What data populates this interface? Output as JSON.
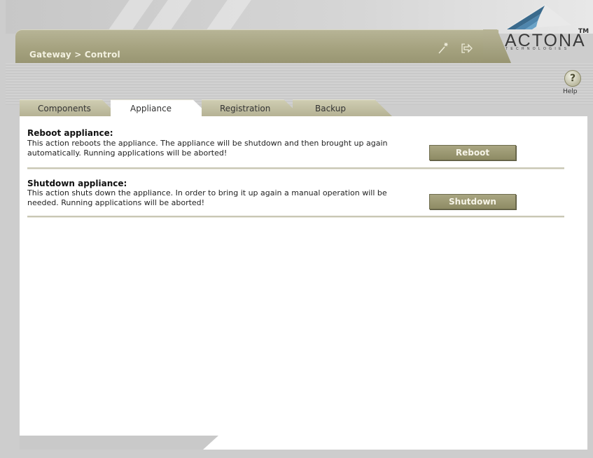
{
  "header": {
    "breadcrumb": "Gateway > Control",
    "icons": [
      "wand-icon",
      "logout-icon"
    ],
    "logo": {
      "word": "ACTONA",
      "tm": "TM",
      "subtitle": "TECHNOLOGIES"
    }
  },
  "toolbar": {
    "help_label": "Help",
    "help_glyph": "?"
  },
  "tabs": [
    {
      "label": "Components",
      "active": false
    },
    {
      "label": "Appliance",
      "active": true
    },
    {
      "label": "Registration",
      "active": false
    },
    {
      "label": "Backup",
      "active": false
    }
  ],
  "sections": [
    {
      "title": "Reboot appliance:",
      "description": "This action reboots the appliance. The appliance will be shutdown and then brought up again automatically. Running applications will be aborted!",
      "button": "Reboot"
    },
    {
      "title": "Shutdown appliance:",
      "description": "This action shuts down the appliance. In order to bring it up again a manual operation will be needed. Running applications will be aborted!",
      "button": "Shutdown"
    }
  ],
  "colors": {
    "accent": "#9a9774",
    "panel": "#ffffff",
    "background": "#cdcdcd"
  }
}
